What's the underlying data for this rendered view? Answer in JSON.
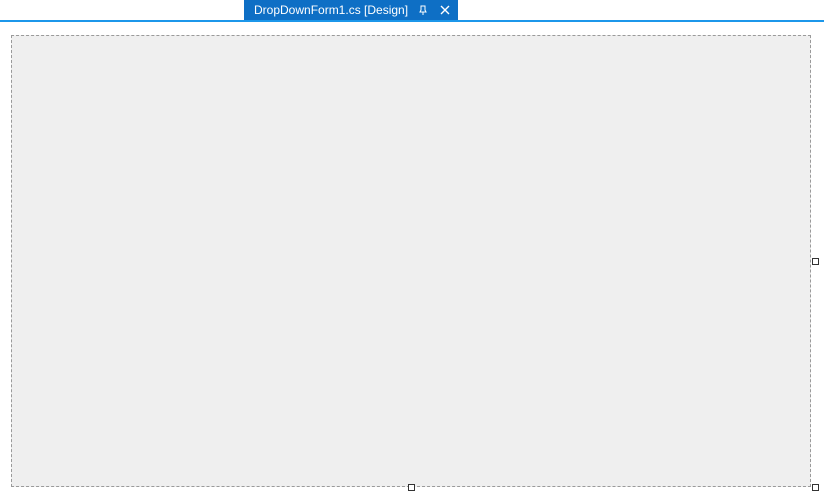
{
  "tabs": {
    "active": {
      "label": "DropDownForm1.cs [Design]"
    }
  }
}
